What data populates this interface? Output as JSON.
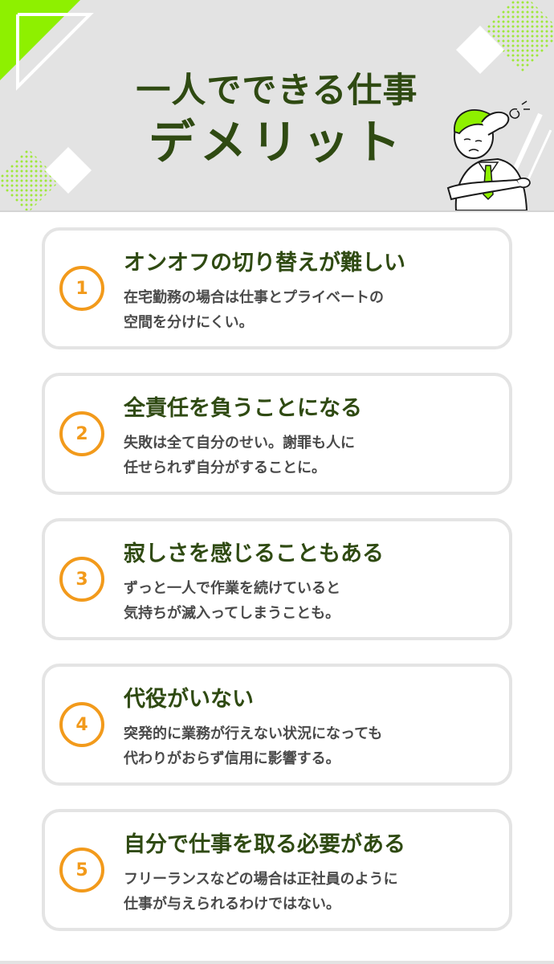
{
  "header": {
    "title_line1": "一人でできる仕事",
    "title_line2": "デメリット"
  },
  "items": [
    {
      "number": "1",
      "title": "オンオフの切り替えが難しい",
      "desc": [
        "在宅勤務の場合は仕事とプライベートの",
        "空間を分けにくい。"
      ]
    },
    {
      "number": "2",
      "title": "全責任を負うことになる",
      "desc": [
        "失敗は全て自分のせい。謝罪も人に",
        "任せられず自分がすることに。"
      ]
    },
    {
      "number": "3",
      "title": "寂しさを感じることもある",
      "desc": [
        "ずっと一人で作業を続けていると",
        "気持ちが滅入ってしまうことも。"
      ]
    },
    {
      "number": "4",
      "title": "代役がいない",
      "desc": [
        "突発的に業務が行えない状況になっても",
        "代わりがおらず信用に影響する。"
      ]
    },
    {
      "number": "5",
      "title": "自分で仕事を取る必要がある",
      "desc": [
        "フリーランスなどの場合は正社員のように",
        "仕事が与えられるわけではない。"
      ]
    }
  ],
  "colors": {
    "accent_green": "#8ef000",
    "title_dark_green": "#2f4a12",
    "number_orange": "#f29a1b",
    "header_gray": "#e3e3e3"
  },
  "icons": [
    "worried-businessman-illustration"
  ]
}
